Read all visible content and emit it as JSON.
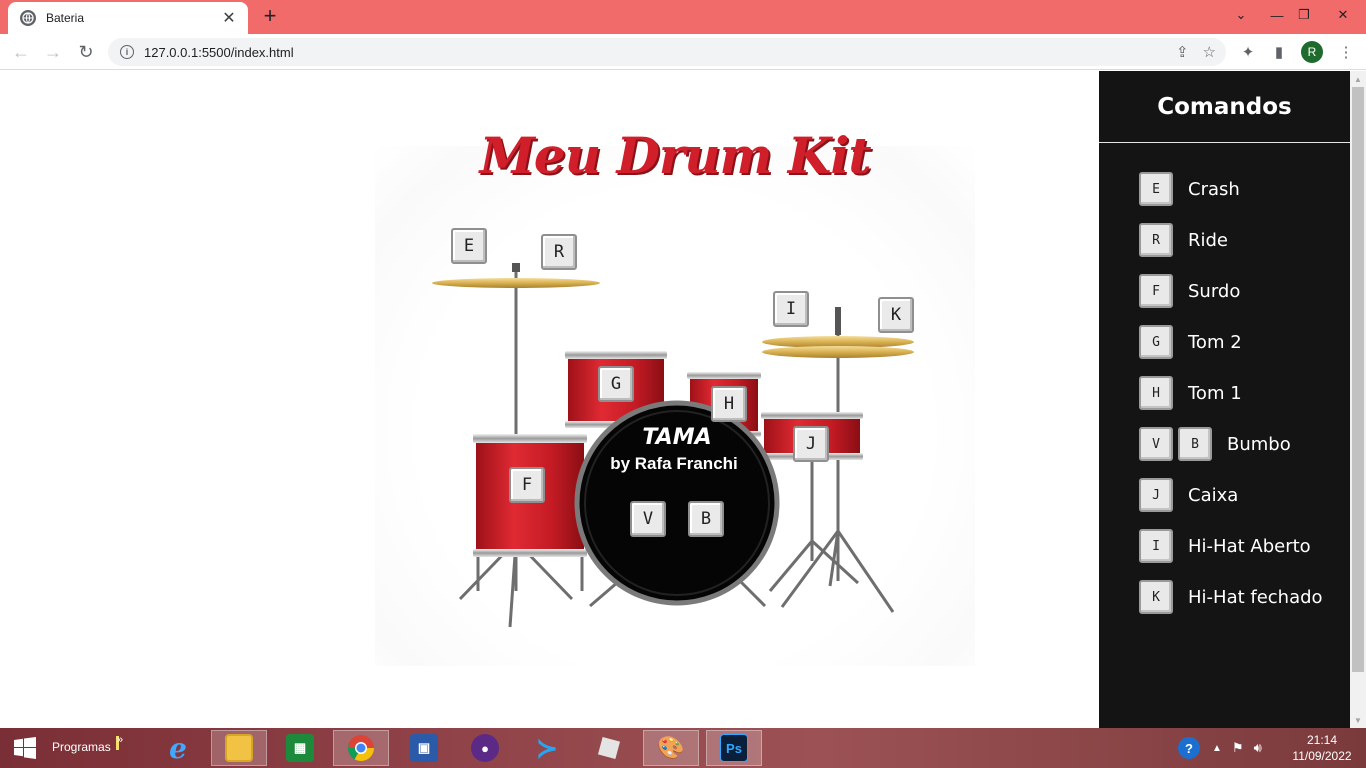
{
  "browser": {
    "tab_title": "Bateria",
    "new_tab": "+",
    "url": "127.0.0.1:5500/index.html",
    "avatar_letter": "R"
  },
  "page": {
    "title": "Meu Drum Kit",
    "brand": "TAMA",
    "brand_sub": "by Rafa Franchi",
    "kit_keys": {
      "e": "E",
      "r": "R",
      "i": "I",
      "k": "K",
      "g": "G",
      "h": "H",
      "j": "J",
      "f": "F",
      "v": "V",
      "b": "B"
    }
  },
  "sidebar": {
    "title": "Comandos",
    "commands": [
      {
        "keys": [
          "E"
        ],
        "label": "Crash"
      },
      {
        "keys": [
          "R"
        ],
        "label": "Ride"
      },
      {
        "keys": [
          "F"
        ],
        "label": "Surdo"
      },
      {
        "keys": [
          "G"
        ],
        "label": "Tom 2"
      },
      {
        "keys": [
          "H"
        ],
        "label": "Tom 1"
      },
      {
        "keys": [
          "V",
          "B"
        ],
        "label": "Bumbo"
      },
      {
        "keys": [
          "J"
        ],
        "label": "Caixa"
      },
      {
        "keys": [
          "I"
        ],
        "label": "Hi-Hat Aberto"
      },
      {
        "keys": [
          "K"
        ],
        "label": "Hi-Hat fechado"
      }
    ]
  },
  "taskbar": {
    "programs_label": "Programas",
    "chevron": "»",
    "time": "21:14",
    "date": "11/09/2022",
    "ps_label": "Ps"
  },
  "colors": {
    "tabstrip": "#f26b6b",
    "sidebar": "#141414",
    "title_red": "#d01f2a",
    "drum_red": "#d3202a"
  }
}
